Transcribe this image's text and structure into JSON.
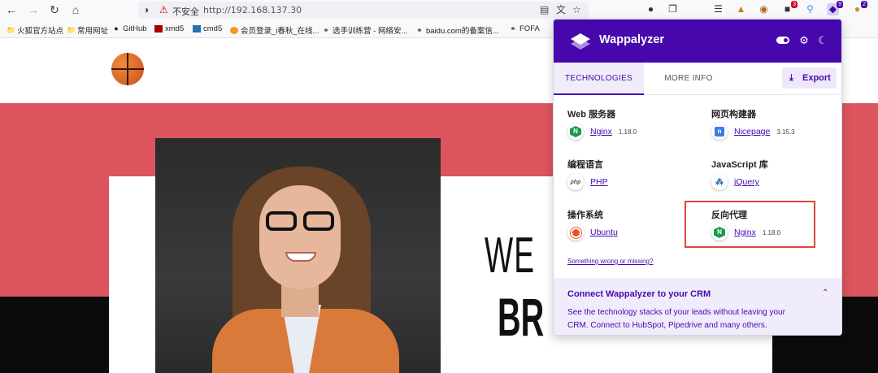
{
  "browser": {
    "nav": {
      "back_icon": "arrow-left",
      "forward_icon": "arrow-right",
      "reload_icon": "reload",
      "home_icon": "home"
    },
    "urlbar": {
      "insecure_label": "不安全",
      "url": "http://192.168.137.30"
    },
    "badges": {
      "ext_red": "3",
      "wappalyzer": "9",
      "ext_purple": "2"
    }
  },
  "bookmarks": [
    {
      "label": "火狐官方站点",
      "icon": "folder-icon"
    },
    {
      "label": "常用网址",
      "icon": "folder-icon"
    },
    {
      "label": "GitHub",
      "icon": "github-icon"
    },
    {
      "label": "xmd5",
      "icon": "site-icon"
    },
    {
      "label": "cmd5",
      "icon": "site-icon"
    },
    {
      "label": "会员登录_i春秋_在线...",
      "icon": "site-icon"
    },
    {
      "label": "选手训练营 - 网络安...",
      "icon": "globe-icon"
    },
    {
      "label": "baidu.com的备案信...",
      "icon": "globe-icon"
    },
    {
      "label": "FOFA",
      "icon": "globe-icon"
    }
  ],
  "page": {
    "hero_line1": "WE",
    "hero_line2": "BR"
  },
  "wappalyzer": {
    "title": "Wappalyzer",
    "tabs": {
      "technologies": "TECHNOLOGIES",
      "more_info": "MORE INFO"
    },
    "export_label": "Export",
    "categories": {
      "web_server": {
        "label": "Web 服务器",
        "name": "Nginx",
        "version": "1.18.0"
      },
      "page_builder": {
        "label": "网页构建器",
        "name": "Nicepage",
        "version": "3.15.3"
      },
      "language": {
        "label": "编程语言",
        "name": "PHP"
      },
      "js_library": {
        "label": "JavaScript 库",
        "name": "jQuery"
      },
      "os": {
        "label": "操作系统",
        "name": "Ubuntu"
      },
      "reverse_proxy": {
        "label": "反向代理",
        "name": "Nginx",
        "version": "1.18.0"
      }
    },
    "wrong_link": "Something wrong or missing?",
    "crm": {
      "title": "Connect Wappalyzer to your CRM",
      "text": "See the technology stacks of your leads without leaving your CRM. Connect to HubSpot, Pipedrive and many others."
    }
  }
}
